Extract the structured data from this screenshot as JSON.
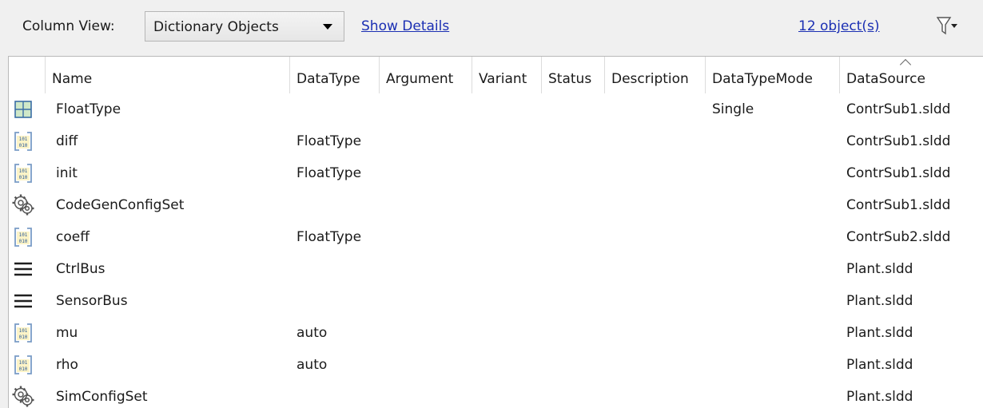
{
  "toolbar": {
    "column_view_label": "Column View:",
    "column_view_value": "Dictionary Objects",
    "show_details": "Show Details",
    "object_count": "12 object(s)"
  },
  "columns": {
    "name": "Name",
    "datatype": "DataType",
    "argument": "Argument",
    "variant": "Variant",
    "status": "Status",
    "description": "Description",
    "datatypemode": "DataTypeMode",
    "datasource": "DataSource"
  },
  "rows": [
    {
      "icon": "numeric-type-icon",
      "name": "FloatType",
      "datatype": "",
      "datatypemode": "Single",
      "datasource": "ContrSub1.sldd"
    },
    {
      "icon": "parameter-icon",
      "name": "diff",
      "datatype": "FloatType",
      "datatypemode": "",
      "datasource": "ContrSub1.sldd"
    },
    {
      "icon": "parameter-icon",
      "name": "init",
      "datatype": "FloatType",
      "datatypemode": "",
      "datasource": "ContrSub1.sldd"
    },
    {
      "icon": "config-set-icon",
      "name": "CodeGenConfigSet",
      "datatype": "",
      "datatypemode": "",
      "datasource": "ContrSub1.sldd"
    },
    {
      "icon": "parameter-icon",
      "name": "coeff",
      "datatype": "FloatType",
      "datatypemode": "",
      "datasource": "ContrSub2.sldd"
    },
    {
      "icon": "bus-icon",
      "name": "CtrlBus",
      "datatype": "",
      "datatypemode": "",
      "datasource": "Plant.sldd"
    },
    {
      "icon": "bus-icon",
      "name": "SensorBus",
      "datatype": "",
      "datatypemode": "",
      "datasource": "Plant.sldd"
    },
    {
      "icon": "parameter-icon",
      "name": "mu",
      "datatype": "auto",
      "datatypemode": "",
      "datasource": "Plant.sldd"
    },
    {
      "icon": "parameter-icon",
      "name": "rho",
      "datatype": "auto",
      "datatypemode": "",
      "datasource": "Plant.sldd"
    },
    {
      "icon": "config-set-icon",
      "name": "SimConfigSet",
      "datatype": "",
      "datatypemode": "",
      "datasource": "Plant.sldd"
    }
  ]
}
